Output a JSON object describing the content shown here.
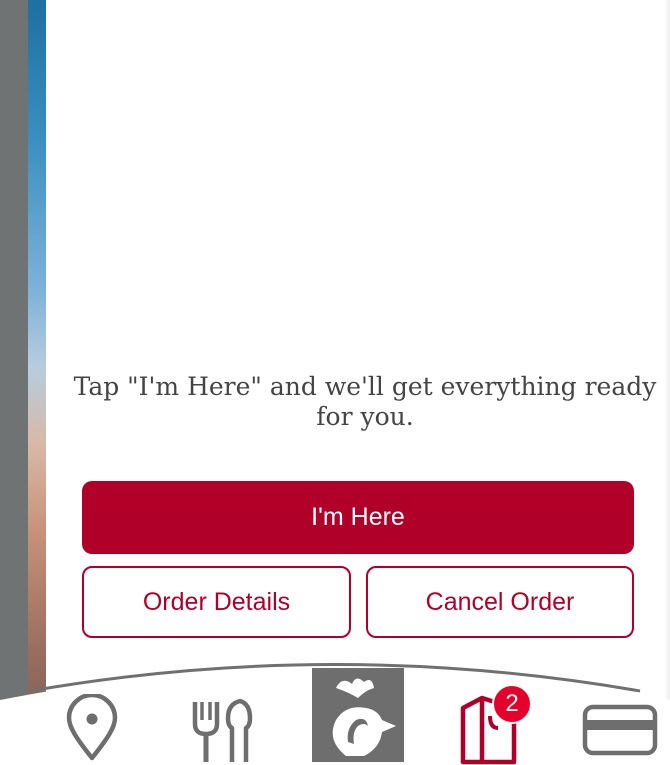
{
  "message": "Tap \"I'm Here\" and we'll get everything ready for you.",
  "buttons": {
    "primary_label": "I'm Here",
    "details_label": "Order Details",
    "cancel_label": "Cancel Order"
  },
  "tabbar": {
    "items": [
      {
        "icon": "location-pin-icon"
      },
      {
        "icon": "fork-knife-icon"
      },
      {
        "icon": "chick-fil-a-logo-icon"
      },
      {
        "icon": "shopping-bag-icon",
        "badge": "2"
      },
      {
        "icon": "credit-card-icon"
      }
    ]
  },
  "colors": {
    "brand_red": "#b00029",
    "badge_red": "#e4002b",
    "text_gray": "#444444",
    "icon_gray": "#6e6e6e"
  }
}
